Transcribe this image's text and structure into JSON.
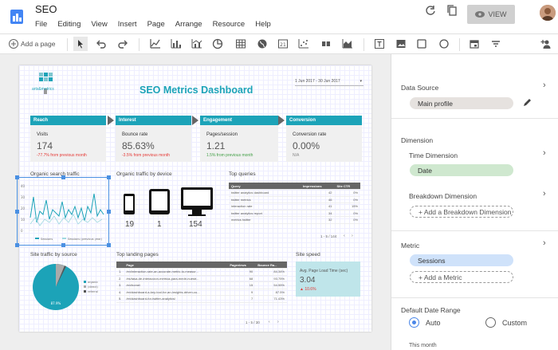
{
  "app": {
    "title": "SEO",
    "menus": [
      "File",
      "Editing",
      "View",
      "Insert",
      "Page",
      "Arrange",
      "Resource",
      "Help"
    ],
    "view_label": "VIEW"
  },
  "toolbar": {
    "add_page": "Add a page"
  },
  "report": {
    "title": "SEO Metrics Dashboard",
    "logo_text": "arts&metrics",
    "date_range": "1 Jun 2017 - 30 Jun 2017",
    "kpis": [
      {
        "section": "Reach",
        "metric": "Visits",
        "value": "174",
        "delta": "-77.7% from previous month",
        "delta_color": "#e53935"
      },
      {
        "section": "Interest",
        "metric": "Bounce rate",
        "value": "85.63%",
        "delta": "-3.5% from previous month",
        "delta_color": "#e53935"
      },
      {
        "section": "Engagement",
        "metric": "Pages/session",
        "value": "1.21",
        "delta": "1.5% from previous month",
        "delta_color": "#43a047"
      },
      {
        "section": "Conversion",
        "metric": "Conversion rate",
        "value": "0.00%",
        "delta": "N/A",
        "delta_color": "#888"
      }
    ],
    "organic_search": {
      "title": "Organic search traffic",
      "y_ticks": [
        "40",
        "30",
        "20",
        "10",
        "0"
      ],
      "legend": [
        "Sessions",
        "Sessions (previous year)"
      ]
    },
    "device": {
      "title": "Organic traffic by device",
      "values": [
        "19",
        "1",
        "154"
      ]
    },
    "top_queries": {
      "title": "Top queries",
      "headers": [
        "Query",
        "Impressions",
        "Site CTR"
      ],
      "rows": [
        [
          "twitter analytics dashboard",
          "42",
          "0%"
        ],
        [
          "twitter metrics",
          "46",
          "0%"
        ],
        [
          "interaction rate",
          "41",
          "15%"
        ],
        [
          "twitter analytics report",
          "34",
          "0%"
        ],
        [
          "metrics twitter",
          "32",
          "0%"
        ]
      ],
      "pager": "1 - 5 / 144"
    },
    "site_traffic": {
      "title": "Site traffic by source",
      "legend": [
        "organic",
        "(direct)",
        "referral"
      ],
      "slice_label": "87.9%"
    },
    "landing": {
      "title": "Top landing pages",
      "headers": [
        "Page",
        "Pageviews",
        "Bounce Ra..."
      ],
      "rows": [
        [
          "1.",
          "/en/interaction-rate-an-accurate-metric-to-measur...",
          "90",
          "84.34%"
        ],
        [
          "2.",
          "/es/tasa-de-interaccion-metrica-para-medir-nuestr...",
          "68",
          "93.75%"
        ],
        [
          "3.",
          "/en/home/",
          "15",
          "54.55%"
        ],
        [
          "4.",
          "/en/dashboard-a-key-tool-for-an-insights-driven-cu...",
          "9",
          "87.5%"
        ],
        [
          "5.",
          "/en/dashboard-for-twitter-analytics/",
          "7",
          "71.43%"
        ]
      ],
      "pager": "1 - 5 / 30"
    },
    "speed": {
      "title": "Site speed",
      "metric": "Avg. Page Load Time (sec)",
      "value": "3.04",
      "delta": "10.6%"
    }
  },
  "panel": {
    "data_source": {
      "label": "Data Source",
      "value": "Main profile"
    },
    "dimension": {
      "label": "Dimension",
      "time_label": "Time Dimension",
      "time_value": "Date",
      "breakdown_label": "Breakdown Dimension",
      "breakdown_add": "+ Add a Breakdown Dimension"
    },
    "metric": {
      "label": "Metric",
      "value": "Sessions",
      "add": "+ Add a Metric"
    },
    "date_range": {
      "label": "Default Date Range",
      "auto": "Auto",
      "custom": "Custom",
      "sub": "This month"
    }
  },
  "colors": {
    "accent": "#1ca3b8",
    "chip_gray": "#e6e2df",
    "chip_green": "#cfe8cf",
    "chip_blue": "#cfe2fa"
  }
}
